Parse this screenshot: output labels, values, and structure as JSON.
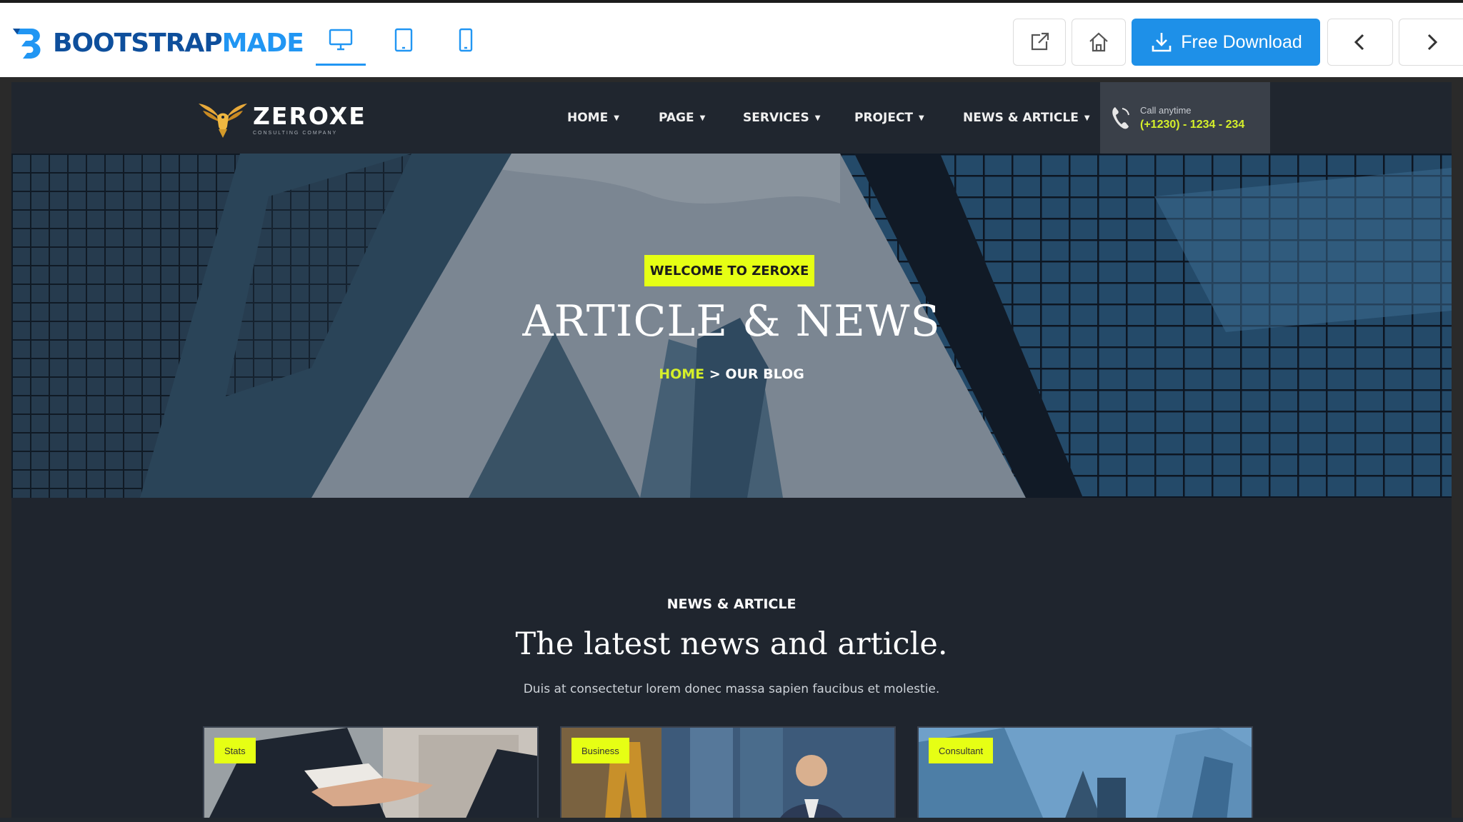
{
  "preview_bar": {
    "brand": {
      "part1": "BOOTSTRAP",
      "part2": "MADE"
    },
    "devices": [
      "desktop-icon",
      "tablet-icon",
      "phone-icon"
    ],
    "download_label": "Free Download"
  },
  "site": {
    "logo": {
      "name": "ZEROXE",
      "tagline": "CONSULTING COMPANY"
    },
    "menu": [
      {
        "label": "HOME"
      },
      {
        "label": "PAGE"
      },
      {
        "label": "SERVICES"
      },
      {
        "label": "PROJECT"
      },
      {
        "label": "NEWS & ARTICLE"
      }
    ],
    "call": {
      "label": "Call anytime",
      "number": "(+1230) - 1234 - 234"
    }
  },
  "hero": {
    "badge": "WELCOME TO ZEROXE",
    "title": "ARTICLE & NEWS",
    "breadcrumb_home": "HOME",
    "breadcrumb_sep": " > ",
    "breadcrumb_current": "OUR BLOG"
  },
  "section": {
    "kicker": "NEWS & ARTICLE",
    "title": "The latest news and article.",
    "description": "Duis at consectetur lorem donec massa sapien faucibus et molestie."
  },
  "cards": [
    {
      "tag": "Stats"
    },
    {
      "tag": "Business"
    },
    {
      "tag": "Consultant"
    }
  ],
  "colors": {
    "accent": "#e6ff14",
    "primary_button": "#1e90e8",
    "dark_bg": "#1f252e"
  }
}
